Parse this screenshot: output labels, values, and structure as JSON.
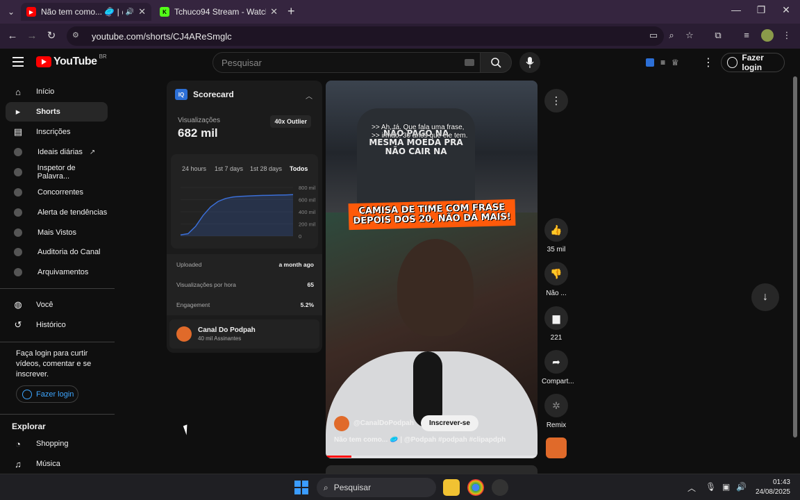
{
  "browser": {
    "tabs": [
      {
        "title": "Não tem como... 🥏 | @Podpah",
        "active": true
      },
      {
        "title": "Tchuco94 Stream - Watch Live o",
        "active": false
      }
    ],
    "url": "youtube.com/shorts/CJ4AReSmglc"
  },
  "masthead": {
    "logo_text": "YouTube",
    "country_code": "BR",
    "search_placeholder": "Pesquisar",
    "login_label": "Fazer login"
  },
  "sidebar": {
    "items": [
      {
        "label": "Início",
        "icon": "home-icon"
      },
      {
        "label": "Shorts",
        "icon": "shorts-icon",
        "active": true
      },
      {
        "label": "Inscrições",
        "icon": "subscriptions-icon"
      },
      {
        "label": "Ideais diárias",
        "icon": "vidiq-icon",
        "external": true
      },
      {
        "label": "Inspetor de Palavra...",
        "icon": "vidiq-icon"
      },
      {
        "label": "Concorrentes",
        "icon": "vidiq-icon"
      },
      {
        "label": "Alerta de tendências",
        "icon": "vidiq-icon"
      },
      {
        "label": "Mais Vistos",
        "icon": "vidiq-icon"
      },
      {
        "label": "Auditoria do Canal",
        "icon": "vidiq-icon"
      },
      {
        "label": "Arquivamentos",
        "icon": "vidiq-icon"
      }
    ],
    "you_items": [
      {
        "label": "Você",
        "icon": "user-icon"
      },
      {
        "label": "Histórico",
        "icon": "history-icon"
      }
    ],
    "login_message": "Faça login para curtir vídeos, comentar e se inscrever.",
    "login_button": "Fazer login",
    "explore_title": "Explorar",
    "explore_items": [
      {
        "label": "Shopping",
        "icon": "shopping-icon"
      },
      {
        "label": "Música",
        "icon": "music-icon"
      }
    ]
  },
  "scorecard": {
    "title": "Scorecard",
    "logo_text": "IQ",
    "views_label": "Visualizações",
    "views_value": "682 mil",
    "outlier_badge": "40x Outlier",
    "ranges": [
      "24 hours",
      "1st 7 days",
      "1st 28 days",
      "Todos"
    ],
    "active_range": "Todos",
    "stats": [
      {
        "label": "Uploaded",
        "value": "a month ago"
      },
      {
        "label": "Visualizações por hora",
        "value": "65"
      },
      {
        "label": "Engagement",
        "value": "5.2%"
      }
    ],
    "channel_name": "Canal Do Podpah",
    "channel_subs": "40 mil Assinantes"
  },
  "chart_data": {
    "type": "area",
    "y_tick_labels": [
      "800 mil",
      "600 mil",
      "400 mil",
      "200 mil",
      "0"
    ],
    "ylim": [
      0,
      800000
    ],
    "x": [
      0,
      1,
      2,
      3,
      4,
      5,
      6,
      7,
      8,
      9,
      10,
      11,
      12,
      13,
      14,
      15
    ],
    "values": [
      20000,
      40000,
      160000,
      340000,
      480000,
      570000,
      620000,
      645000,
      655000,
      660000,
      665000,
      670000,
      672000,
      675000,
      678000,
      682000
    ],
    "grid": true,
    "accent": "#3b6fd8"
  },
  "short": {
    "subtitle": ">> Ah, tá. Que fala uma frase,\n>> irmão. 30 anos que ele tem.",
    "shirt_text": "NÃO PAGO NA MESMA MOEDA PRA NÃO CAIR NA",
    "banner_line1": "CAMISA DE TIME COM FRASE",
    "banner_line2": "DEPOIS DOS 20, NÃO DÁ MAIS!",
    "channel_handle": "@CanalDoPodpah",
    "subscribe_label": "Inscrever-se",
    "title": "Não tem como... 🥏 | @Podpah #podpah #clipapdph",
    "progress": 0.12
  },
  "actions": {
    "likes": "35 mil",
    "dislike": "Não ...",
    "comments": "221",
    "share": "Compart...",
    "remix": "Remix"
  },
  "taskbar": {
    "search_placeholder": "Pesquisar",
    "time": "01:43",
    "date": "24/08/2025"
  }
}
